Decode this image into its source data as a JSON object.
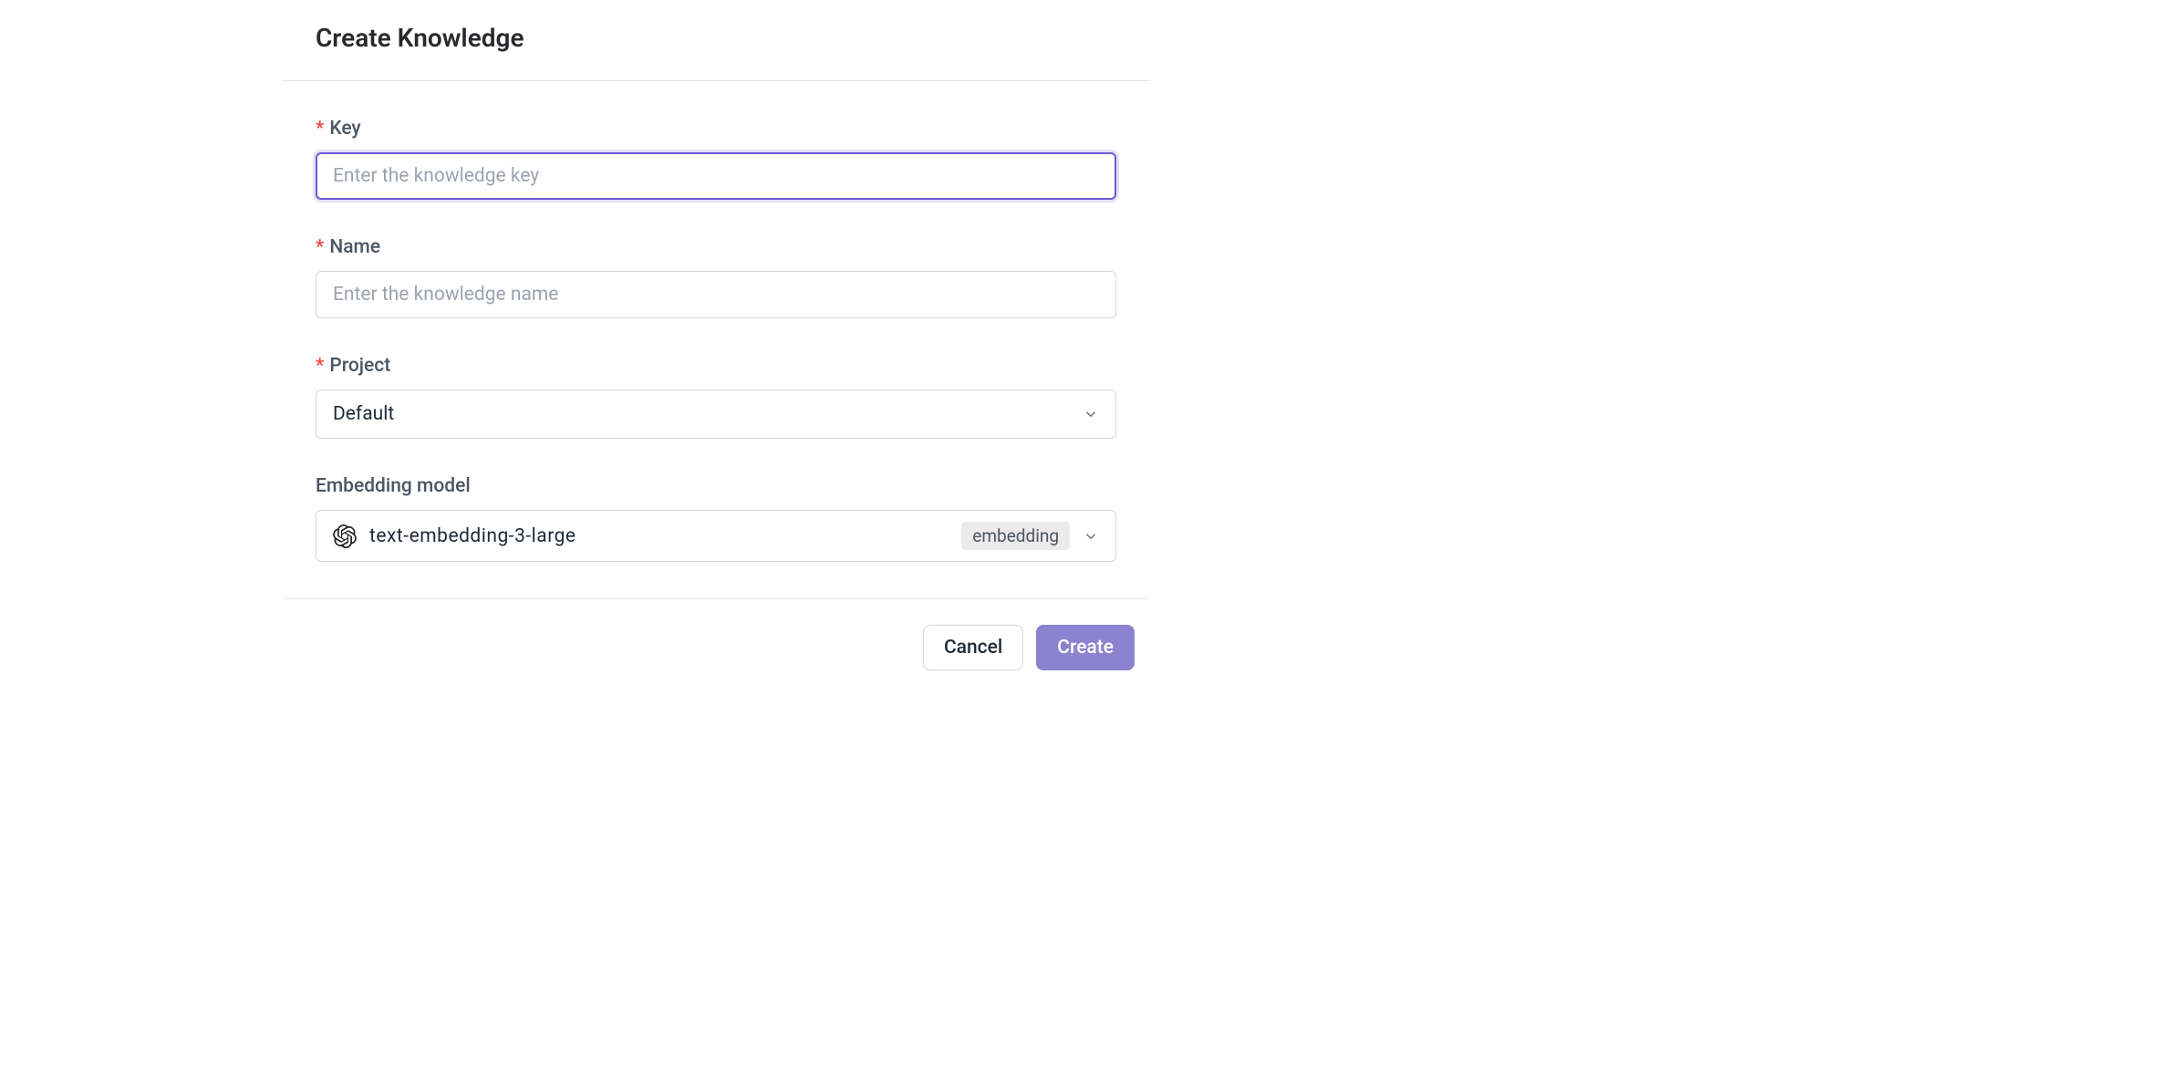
{
  "header": {
    "title": "Create Knowledge"
  },
  "fields": {
    "key": {
      "label": "Key",
      "placeholder": "Enter the knowledge key",
      "value": ""
    },
    "name": {
      "label": "Name",
      "placeholder": "Enter the knowledge name",
      "value": ""
    },
    "project": {
      "label": "Project",
      "selected": "Default"
    },
    "embedding": {
      "label": "Embedding model",
      "model_name": "text-embedding-3-large",
      "tag": "embedding"
    }
  },
  "footer": {
    "cancel_label": "Cancel",
    "create_label": "Create"
  }
}
